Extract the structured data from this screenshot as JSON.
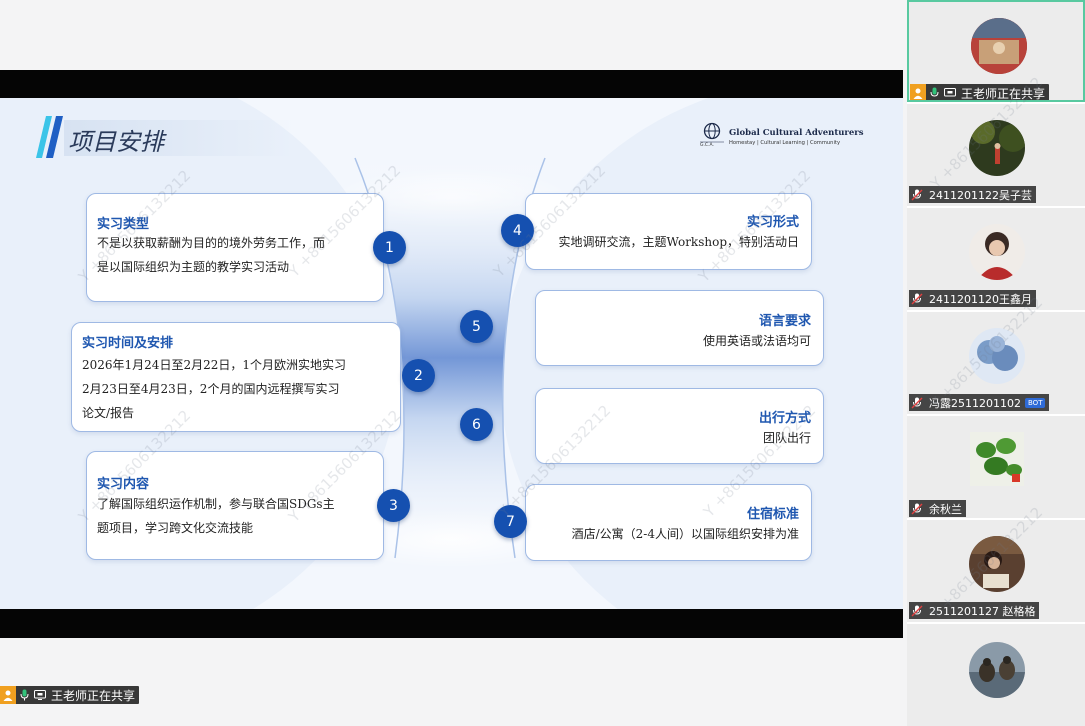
{
  "slide": {
    "title": "项目安排",
    "logo": {
      "name": "Global Cultural Adventurers",
      "tagline": "Homestay | Cultural Learning | Community",
      "abbr": "G.C.A."
    },
    "cards": [
      {
        "number": "1",
        "title": "实习类型",
        "lines": [
          "不是以获取薪酬为目的的境外劳务工作，而",
          "是以国际组织为主题的教学实习活动"
        ]
      },
      {
        "number": "2",
        "title": "实习时间及安排",
        "lines": [
          "2026年1月24日至2月22日，1个月欧洲实地实习",
          "2月23日至4月23日，2个月的国内远程撰写实习",
          "论文/报告"
        ]
      },
      {
        "number": "3",
        "title": "实习内容",
        "lines": [
          "了解国际组织运作机制，参与联合国SDGs主",
          "题项目，学习跨文化交流技能"
        ]
      },
      {
        "number": "4",
        "title": "实习形式",
        "lines": [
          "实地调研交流，主题Workshop，特别活动日"
        ]
      },
      {
        "number": "5",
        "title": "语言要求",
        "lines": [
          "使用英语或法语均可"
        ]
      },
      {
        "number": "6",
        "title": "出行方式",
        "lines": [
          "团队出行"
        ]
      },
      {
        "number": "7",
        "title": "住宿标准",
        "lines": [
          "酒店/公寓（2-4人间）以国际组织安排为准"
        ]
      }
    ],
    "watermark": "Y +8615606132212"
  },
  "share_status": {
    "label": "王老师正在共享"
  },
  "participants": [
    {
      "name": "王老师正在共享",
      "active": true,
      "avatar_icon": "group-photo-avatar",
      "color": "#8a3a3a"
    },
    {
      "name": "2411201122吴子芸",
      "muted": true,
      "avatar_icon": "forest-avatar",
      "color": "#3e5a2a"
    },
    {
      "name": "2411201120王鑫月",
      "muted": true,
      "avatar_icon": "portrait-avatar",
      "color": "#a83030"
    },
    {
      "name": "冯露2511201102",
      "muted": true,
      "bot_badge": "BOT",
      "avatar_icon": "flowers-avatar",
      "color": "#7a9cc8"
    },
    {
      "name": "余秋兰",
      "muted": true,
      "avatar_icon": "plant-avatar",
      "color": "#3f8a2a"
    },
    {
      "name": "2511201127 赵格格",
      "muted": true,
      "avatar_icon": "reading-avatar",
      "color": "#5a4030"
    },
    {
      "name": "",
      "muted": false,
      "avatar_icon": "ducks-avatar",
      "color": "#6a7a8a"
    }
  ]
}
